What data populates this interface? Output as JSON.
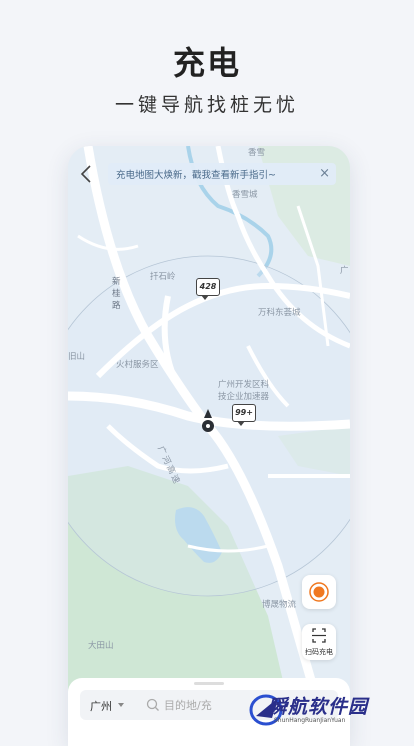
{
  "header": {
    "title": "充电",
    "subtitle": "一键导航找桩无忧"
  },
  "notice": {
    "text": "充电地图大焕新，戳我查看新手指引~",
    "close": "×"
  },
  "map_labels": {
    "xiangxue": "香雪",
    "xiangxuecheng": "香雪城",
    "shishiling": "扦石岭",
    "wanke": "万科东荟城",
    "xinguilu": "新桂路",
    "huocun": "火村服务区",
    "kaifaqu_1": "广州开发区科",
    "kaifaqu_2": "技企业加速器",
    "guanghe": "广河高速",
    "shan_left": "旧山",
    "guang_right": "广",
    "bosheng": "博晟物流",
    "datianshan": "大田山"
  },
  "pins": [
    {
      "label": "428"
    },
    {
      "label": "99+"
    }
  ],
  "controls": {
    "scan_label": "扫码充电"
  },
  "search": {
    "city": "广州",
    "placeholder": "目的地/充"
  },
  "watermark": {
    "text": "瞬航软件园",
    "sub": "ShunHangRuanJianYuan"
  },
  "colors": {
    "accent": "#f07820",
    "location": "#2b2f35",
    "road": "#ffffff",
    "green": "#c8e6cf",
    "water": "#a8d2ea"
  }
}
